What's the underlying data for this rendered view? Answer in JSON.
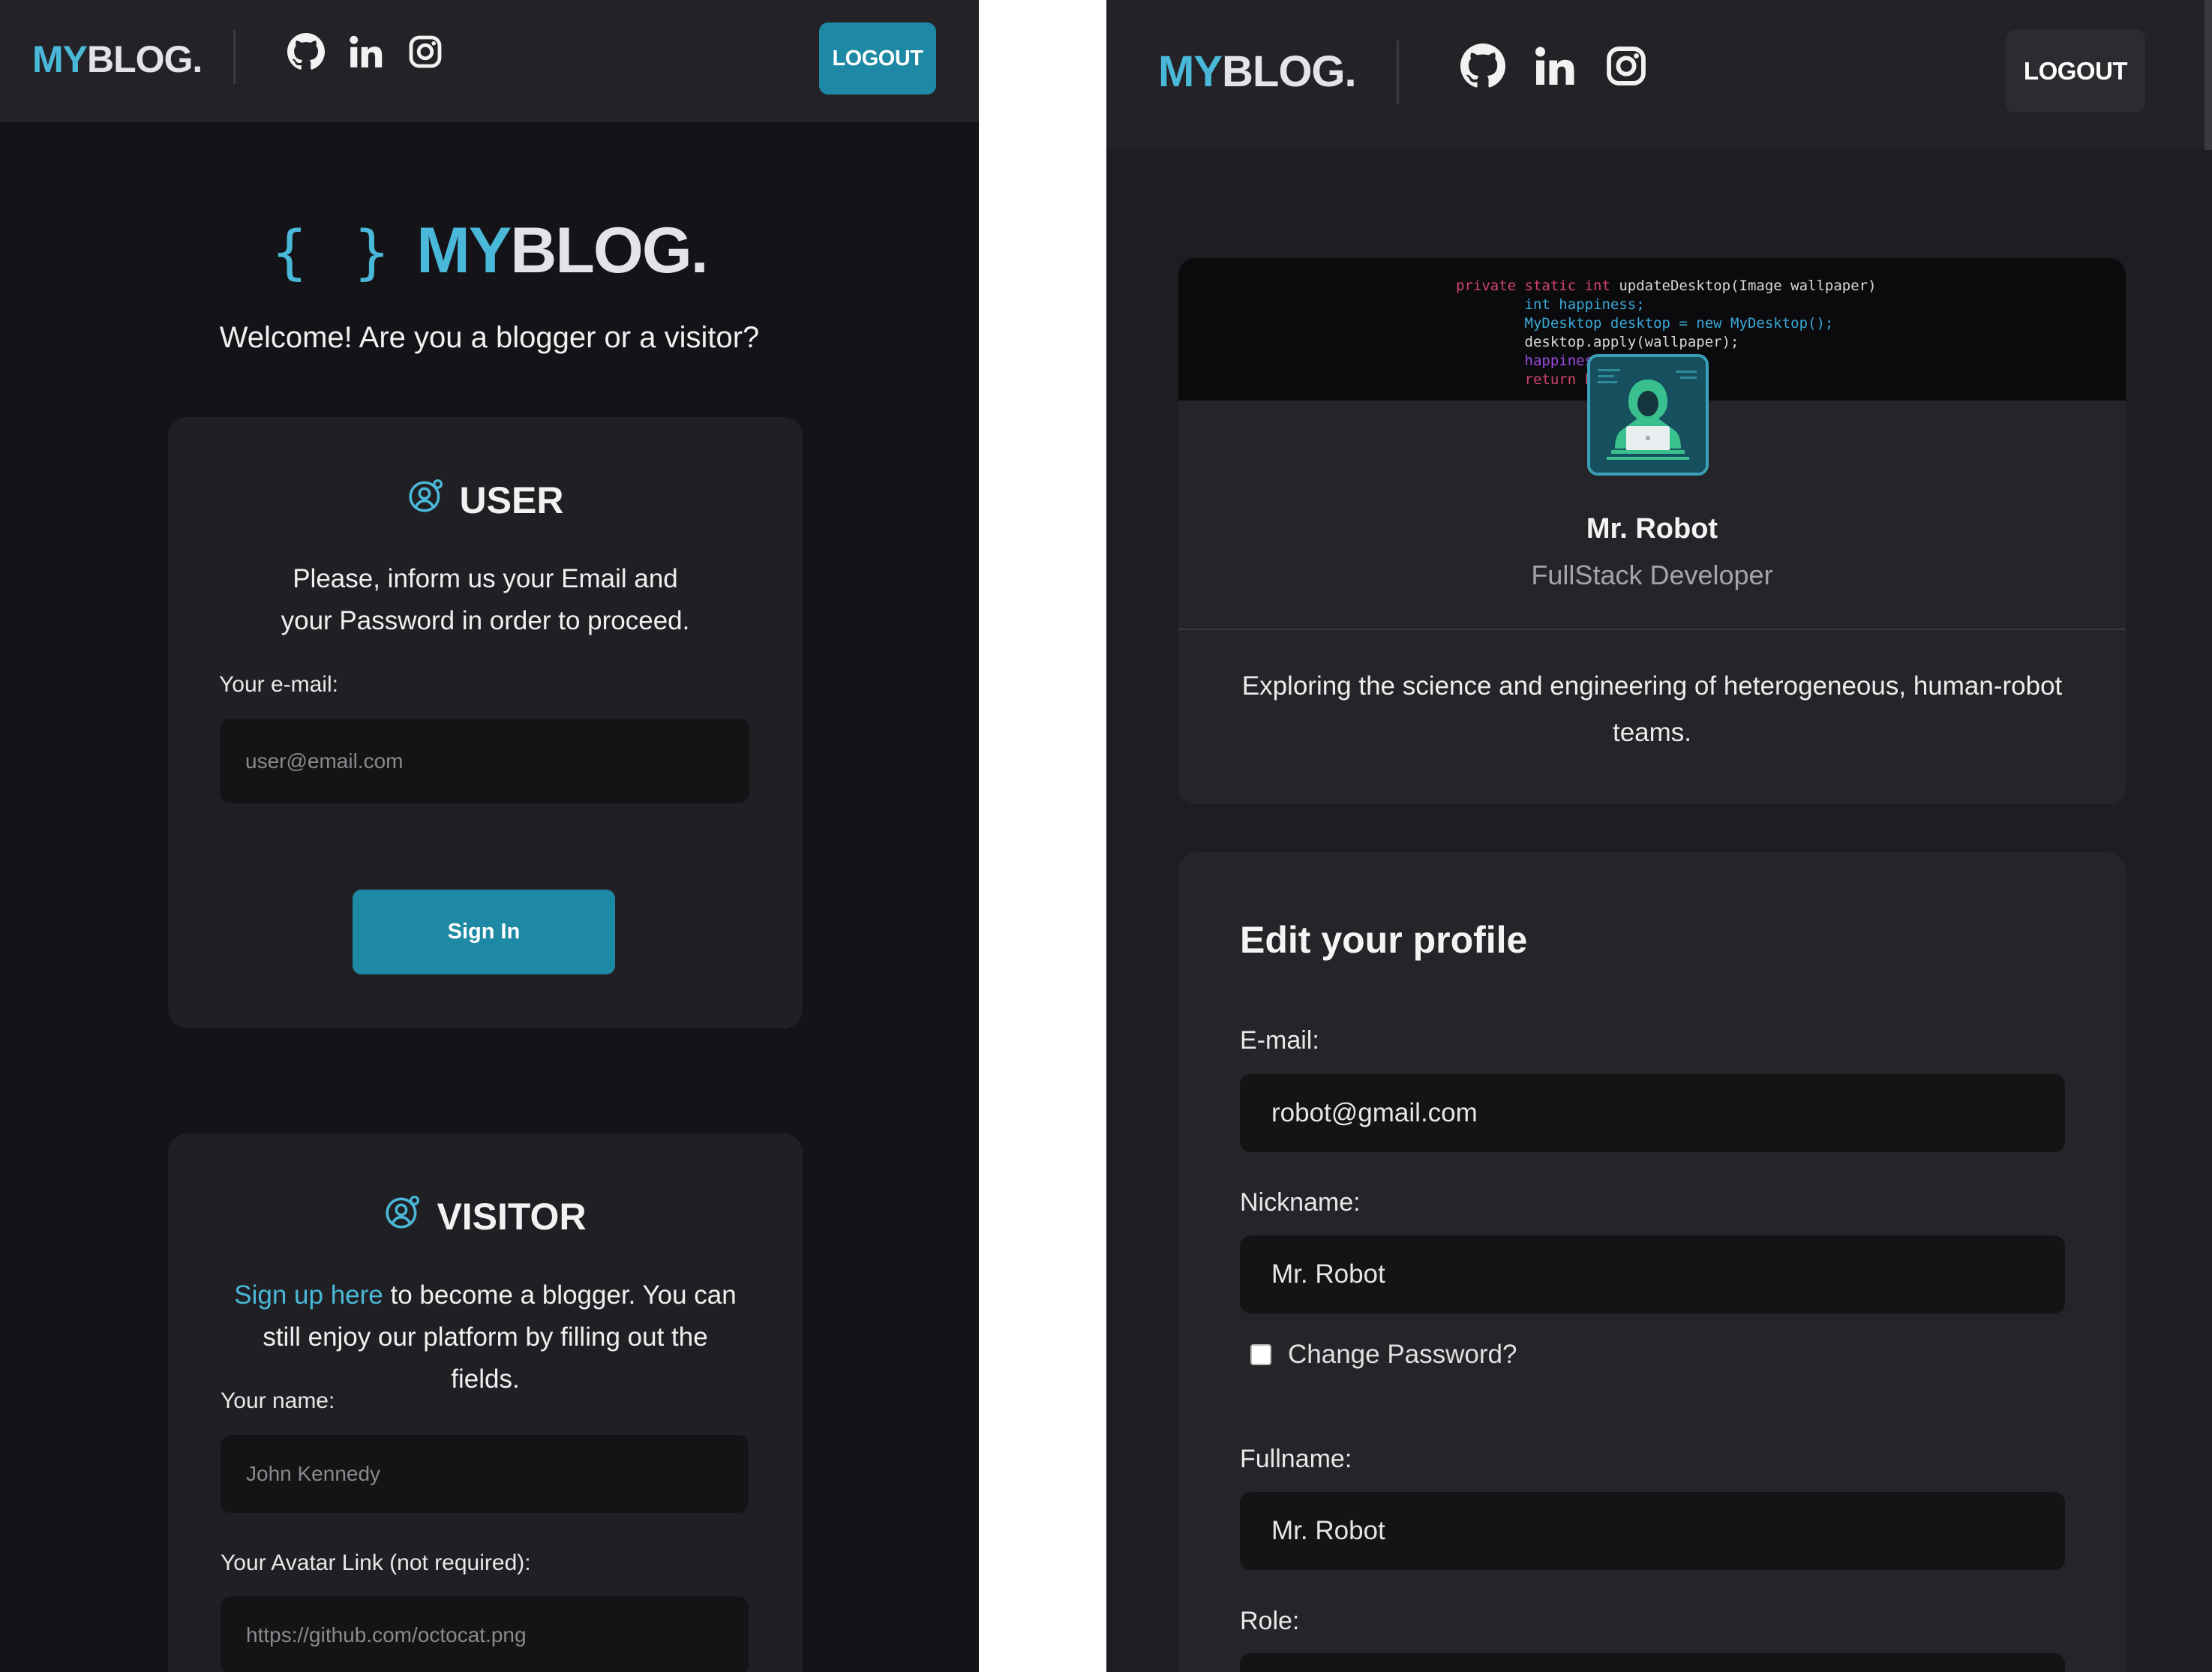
{
  "left": {
    "header": {
      "logo_my": "MY",
      "logo_blog": "BLOG.",
      "social": [
        "github-icon",
        "linkedin-icon",
        "instagram-icon"
      ],
      "logout_label": "LOGOUT",
      "logout_color": "#1e89a4"
    },
    "hero": {
      "braces": "{ }",
      "logo_my": "MY",
      "logo_blog": "BLOG.",
      "welcome": "Welcome! Are you a blogger or a visitor?"
    },
    "user_card": {
      "title": "USER",
      "text": "Please, inform us your Email and your Password in order to proceed.",
      "email_label": "Your e-mail:",
      "email_placeholder": "user@email.com",
      "signin_label": "Sign In"
    },
    "visitor_card": {
      "title": "VISITOR",
      "signup_link": "Sign up here",
      "text_rest": "to become a blogger. You can still enjoy our platform by filling out the fields.",
      "name_label": "Your name:",
      "name_placeholder": "John Kennedy",
      "avatar_label": "Your Avatar Link (not required):",
      "avatar_placeholder": "https://github.com/octocat.png"
    }
  },
  "right": {
    "header": {
      "logo_my": "MY",
      "logo_blog": "BLOG.",
      "social": [
        "github-icon",
        "linkedin-icon",
        "instagram-icon"
      ],
      "logout_label": "LOGOUT",
      "logout_color": "#2c2c30"
    },
    "profile": {
      "cover_code": [
        "private static int updateDesktop(Image wallpaper)",
        "    int happiness;",
        "    MyDesktop desktop = new MyDesktop();",
        "    desktop.apply(wallpaper);",
        "    happiness = INFINITY;",
        "    return happiness;"
      ],
      "name": "Mr. Robot",
      "role": "FullStack Developer",
      "bio": "Exploring the science and engineering of heterogeneous, human-robot teams."
    },
    "edit": {
      "title": "Edit your profile",
      "email_label": "E-mail:",
      "email_value": "robot@gmail.com",
      "nickname_label": "Nickname:",
      "nickname_value": "Mr. Robot",
      "change_password_label": "Change Password?",
      "change_password_checked": false,
      "fullname_label": "Fullname:",
      "fullname_value": "Mr. Robot",
      "role_label": "Role:"
    }
  },
  "colors": {
    "accent": "#4ab8d8",
    "primary_button": "#1e89a4",
    "background": "#141418",
    "card": "#202024"
  }
}
